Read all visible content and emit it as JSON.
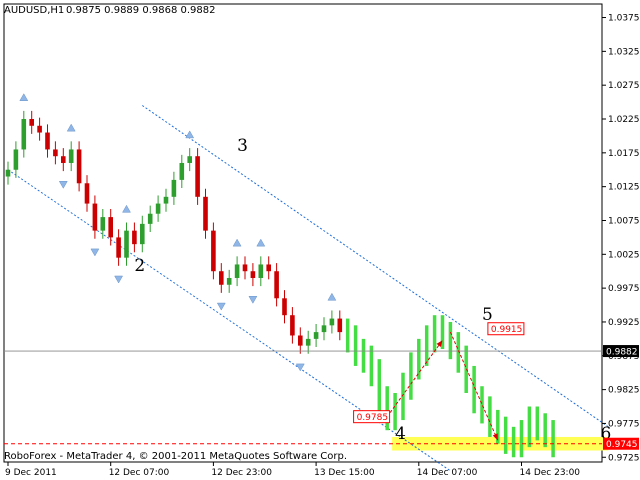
{
  "window": {
    "symbol_label": "AUDUSD,H1",
    "ohlc_label": "0.9875 0.9889 0.9868 0.9882",
    "footer_label": "RoboForex - MetaTrader 4, © 2001-2011 MetaQuotes Software Corp."
  },
  "colors": {
    "background": "#ffffff",
    "bull": "#2e9e2e",
    "bear": "#cc0000",
    "forecast": "#44dd44",
    "channel": "#1e6ed8",
    "fractal": "#8fb6e6",
    "arrow": "#dd0000",
    "highlight": "#ffff55",
    "price_tag_red": "#ff0000",
    "price_tag_black": "#000000"
  },
  "chart_data": {
    "type": "candlestick",
    "title": "AUDUSD,H1",
    "ylim": [
      0.9718,
      1.0395
    ],
    "y_ticks": [
      "1.0375",
      "1.0325",
      "1.0275",
      "1.0225",
      "1.0175",
      "1.0125",
      "1.0075",
      "1.0025",
      "0.9975",
      "0.9925",
      "0.9875",
      "0.9825",
      "0.9775",
      "0.9725"
    ],
    "y_tick_values": [
      1.0375,
      1.0325,
      1.0275,
      1.0225,
      1.0175,
      1.0125,
      1.0075,
      1.0025,
      0.9975,
      0.9925,
      0.9875,
      0.9825,
      0.9775,
      0.9725
    ],
    "x_ticks": [
      "9 Dec 2011",
      "12 Dec 07:00",
      "12 Dec 23:00",
      "13 Dec 15:00",
      "14 Dec 07:00",
      "14 Dec 23:00"
    ],
    "x_tick_index": [
      0,
      13,
      26,
      39,
      52,
      65
    ],
    "grid": false,
    "price_series": [
      1.015,
      1.018,
      1.0225,
      1.0215,
      1.0205,
      1.018,
      1.017,
      1.016,
      1.018,
      1.013,
      1.01,
      1.006,
      1.008,
      1.005,
      1.002,
      1.006,
      1.004,
      1.007,
      1.0085,
      1.01,
      1.011,
      1.0135,
      1.016,
      1.017,
      1.011,
      1.006,
      1.0,
      0.998,
      0.999,
      1.001,
      1.0,
      0.999,
      1.001,
      1.0,
      0.996,
      0.9935,
      0.9905,
      0.989,
      0.99,
      0.991,
      0.992,
      0.993,
      0.991,
      0.99,
      0.988,
      0.987,
      0.985,
      0.981,
      0.9785,
      0.98,
      0.983,
      0.986,
      0.988,
      0.99,
      0.9915,
      0.9905,
      0.989,
      0.987,
      0.984,
      0.981,
      0.9795,
      0.9775,
      0.9765,
      0.975,
      0.9745,
      0.976,
      0.978,
      0.977,
      0.976,
      0.9745
    ],
    "forecast_start_index": 43,
    "current_price": "0.9882",
    "current_price_value": 0.9882,
    "target_price": "0.9745",
    "target_price_value": 0.9745,
    "channel_upper": [
      [
        17,
        1.0245
      ],
      [
        76,
        0.977
      ]
    ],
    "channel_lower": [
      [
        0,
        1.015
      ],
      [
        56,
        0.9705
      ]
    ],
    "wave_labels": [
      {
        "text": "2",
        "index": 16,
        "value": 1.0
      },
      {
        "text": "3",
        "index": 29,
        "value": 1.0178
      },
      {
        "text": "4",
        "index": 49,
        "value": 0.9752
      },
      {
        "text": "5",
        "index": 60,
        "value": 0.9928
      },
      {
        "text": "6",
        "index": 75,
        "value": 0.9752
      }
    ],
    "price_tags": [
      {
        "text": "0.9785",
        "index": 44,
        "value": 0.9785
      },
      {
        "text": "0.9915",
        "index": 61,
        "value": 0.9915
      }
    ],
    "arrows": [
      {
        "from": [
          48,
          0.9785
        ],
        "to": [
          55,
          0.9898
        ]
      },
      {
        "from": [
          56,
          0.991
        ],
        "to": [
          62,
          0.975
        ]
      }
    ],
    "highlight_zone": {
      "from_index": 49,
      "to_index": 76,
      "y_low": 0.9735,
      "y_high": 0.9755
    }
  }
}
